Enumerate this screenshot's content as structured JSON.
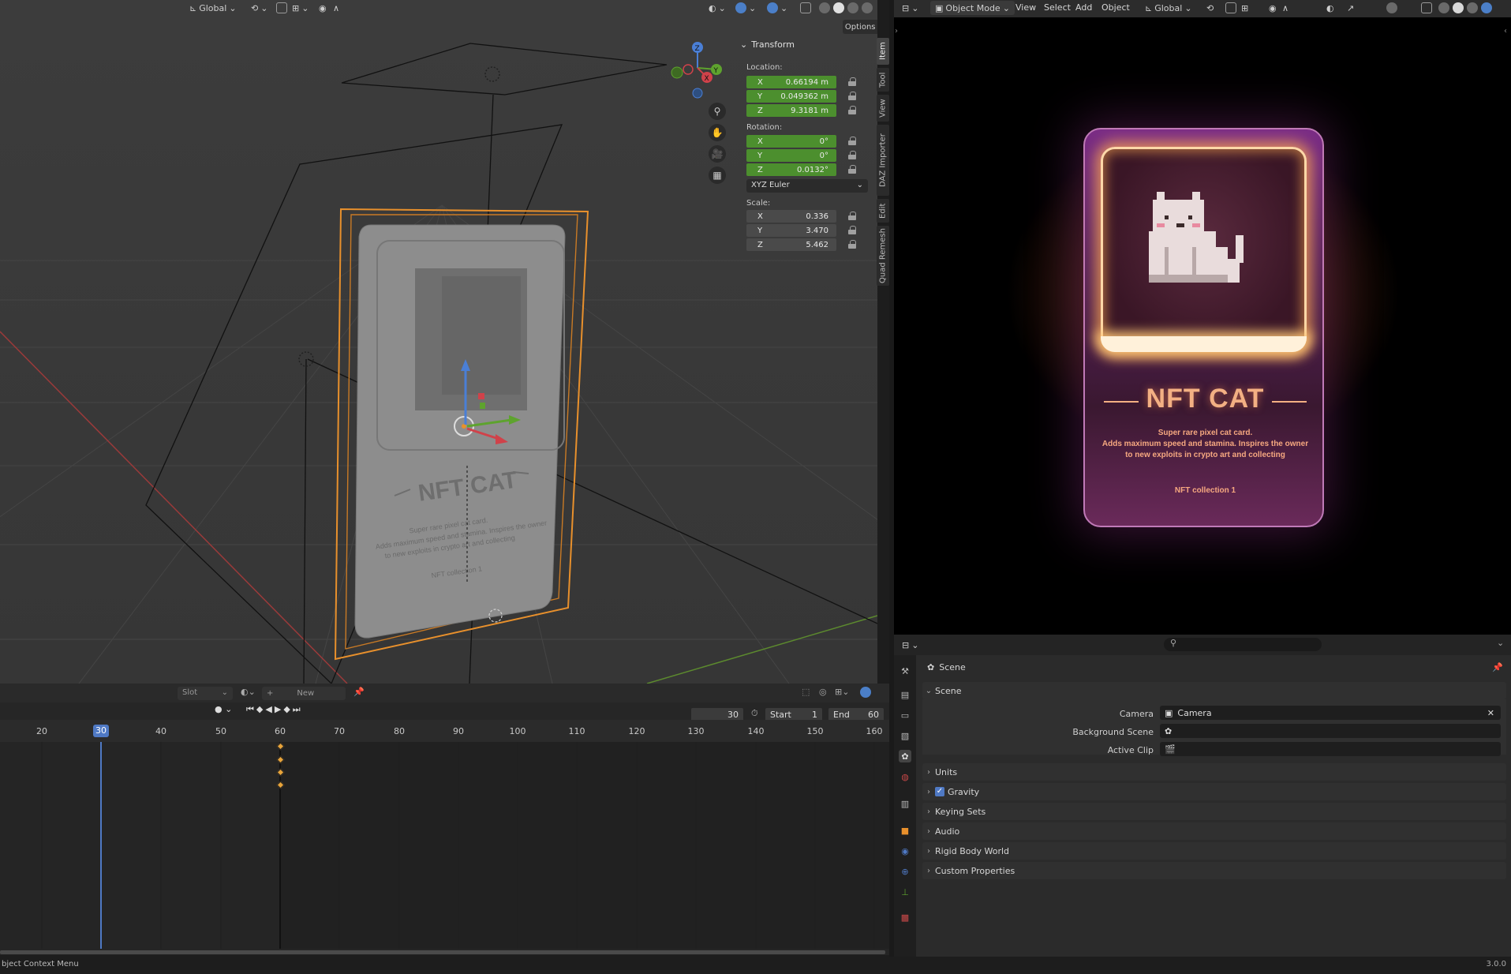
{
  "viewport_header": {
    "orientation": "Global",
    "options_label": "Options"
  },
  "npanel": {
    "title": "Transform",
    "location_label": "Location:",
    "location": [
      {
        "axis": "X",
        "value": "0.66194 m"
      },
      {
        "axis": "Y",
        "value": "0.049362 m"
      },
      {
        "axis": "Z",
        "value": "9.3181 m"
      }
    ],
    "rotation_label": "Rotation:",
    "rotation": [
      {
        "axis": "X",
        "value": "0°"
      },
      {
        "axis": "Y",
        "value": "0°"
      },
      {
        "axis": "Z",
        "value": "0.0132°"
      }
    ],
    "rotation_mode": "XYZ Euler",
    "scale_label": "Scale:",
    "scale": [
      {
        "axis": "X",
        "value": "0.336"
      },
      {
        "axis": "Y",
        "value": "3.470"
      },
      {
        "axis": "Z",
        "value": "5.462"
      }
    ]
  },
  "side_tabs": [
    "Item",
    "Tool",
    "View",
    "DAZ Importer",
    "Edit",
    "Quad Remesh"
  ],
  "gizmo": {
    "x": "X",
    "y": "Y",
    "z": "Z"
  },
  "scene_card_text": {
    "title": "NFT CAT",
    "desc1": "Super rare pixel cat card.",
    "desc2": "Adds maximum speed and stamina. Inspires the owner",
    "desc3": "to new exploits in crypto art and collecting",
    "collection": "NFT collection 1"
  },
  "timeline": {
    "slot_label": "Slot",
    "new_label": "New",
    "current_frame": "30",
    "start_label": "Start",
    "start_value": "1",
    "end_label": "End",
    "end_value": "60",
    "ruler_ticks": [
      "20",
      "30",
      "40",
      "50",
      "60",
      "70",
      "80",
      "90",
      "100",
      "110",
      "120",
      "130",
      "140",
      "150",
      "160"
    ],
    "current_frame_badge": "30"
  },
  "status_bar": {
    "left_text": "bject Context Menu",
    "version": "3.0.0"
  },
  "render_header": {
    "mode": "Object Mode",
    "menus": [
      "View",
      "Select",
      "Add",
      "Object"
    ],
    "orientation": "Global"
  },
  "render_card": {
    "title": "NFT CAT",
    "description_lines": [
      "Super rare pixel cat card.",
      "Adds maximum speed and stamina. Inspires the owner",
      "to new exploits in crypto art and collecting"
    ],
    "collection": "NFT collection 1"
  },
  "properties": {
    "breadcrumb": "Scene",
    "panel_scene": "Scene",
    "camera_label": "Camera",
    "camera_value": "Camera",
    "background_scene_label": "Background Scene",
    "active_clip_label": "Active Clip",
    "subpanels": [
      "Units",
      "Gravity",
      "Keying Sets",
      "Audio",
      "Rigid Body World",
      "Custom Properties"
    ],
    "gravity_checked": true
  },
  "colors": {
    "accent_blue": "#4f79c4",
    "field_green": "#4c8f2e",
    "selection_orange": "#e8902c"
  }
}
